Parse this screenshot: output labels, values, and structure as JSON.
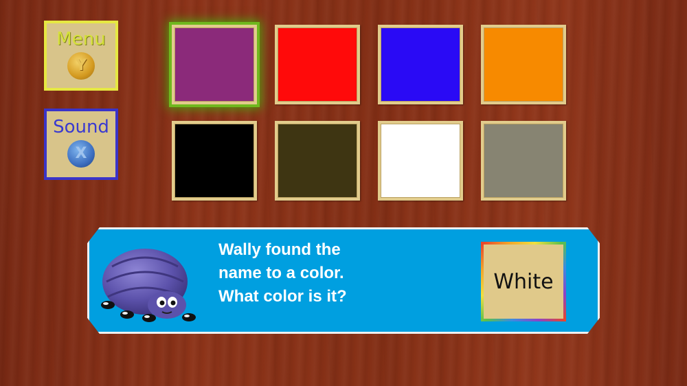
{
  "menu": {
    "label": "Menu",
    "key": "Y"
  },
  "sound": {
    "label": "Sound",
    "key": "X"
  },
  "tiles": [
    {
      "color": "#8b2a7a",
      "selected": true
    },
    {
      "color": "#ff0a0a",
      "selected": false
    },
    {
      "color": "#2a0af5",
      "selected": false
    },
    {
      "color": "#f78a00",
      "selected": false
    },
    {
      "color": "#000000",
      "selected": false
    },
    {
      "color": "#3e3512",
      "selected": false
    },
    {
      "color": "#ffffff",
      "selected": false
    },
    {
      "color": "#878472",
      "selected": false
    }
  ],
  "prompt": {
    "line1": "Wally found the",
    "line2": "name to a color.",
    "line3": "What color is it?"
  },
  "answer": {
    "word": "White"
  }
}
